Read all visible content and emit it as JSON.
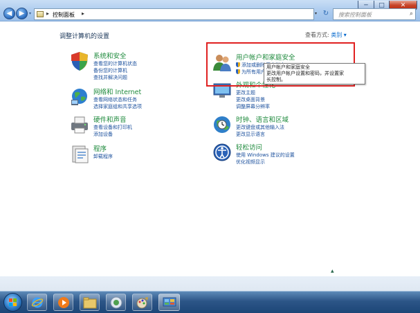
{
  "window": {
    "controls": {
      "minimize": "─",
      "maximize": "□",
      "close": "✕"
    }
  },
  "nav": {
    "back": "◀",
    "forward": "▶",
    "dropdown": "▾"
  },
  "address": {
    "separator": "▸",
    "path": "控制面板",
    "separator2": "▸",
    "dropdown": "▾",
    "refresh": "↻"
  },
  "search": {
    "placeholder": "搜索控制面板",
    "icon": "search-icon"
  },
  "page": {
    "title": "调整计算机的设置",
    "view_by_label": "查看方式:",
    "view_by_value": "类别 ▾"
  },
  "categories": [
    {
      "title": "系统和安全",
      "links": [
        "查看您的计算机状态",
        "备份您的计算机",
        "查找并解决问题"
      ]
    },
    {
      "title": "网络和 Internet",
      "links": [
        "查看网络状态和任务",
        "选择家庭组和共享选项"
      ]
    },
    {
      "title": "硬件和声音",
      "links": [
        "查看设备和打印机",
        "添加设备"
      ]
    },
    {
      "title": "程序",
      "links": [
        "卸载程序"
      ]
    },
    {
      "title": "用户帐户和家庭安全",
      "links": [
        "添加或删除用户帐户",
        "为所有用户设置家"
      ]
    },
    {
      "title": "外观和个性化",
      "links": [
        "更改主题",
        "更改桌面背景",
        "调整屏幕分辨率"
      ]
    },
    {
      "title": "时钟、语言和区域",
      "links": [
        "更改键盘或其他输入法",
        "更改显示语言"
      ]
    },
    {
      "title": "轻松访问",
      "links": [
        "使用 Windows 建议的设置",
        "优化视频显示"
      ]
    }
  ],
  "tooltip": {
    "line1": "用户帐户和家庭安全",
    "line2": "更改用户帐户设置和密码，并设置家",
    "line3": "长控制。"
  },
  "taskbar": {
    "items": [
      "ie-icon",
      "media-player-icon",
      "explorer-icon",
      "media-center-icon",
      "paint-icon",
      "control-panel-icon"
    ]
  },
  "colors": {
    "accent_green": "#1e8a3c",
    "link_blue": "#1a4f9c",
    "highlight_red": "#e02020"
  }
}
